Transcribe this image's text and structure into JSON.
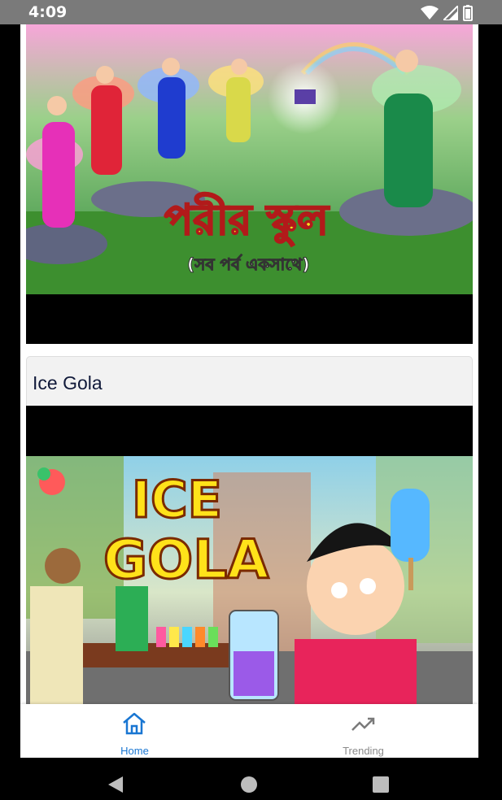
{
  "status_bar": {
    "time": "4:09",
    "icons": [
      "wifi-icon",
      "signal-icon",
      "battery-icon"
    ]
  },
  "videos": [
    {
      "title": "",
      "thumbnail_text": "পরীর স্কুল",
      "thumbnail_subtext": "(সব পর্ব একসাথে)"
    },
    {
      "title": "Ice Gola",
      "thumbnail_text_line1": "ICE",
      "thumbnail_text_line2": "GOLA"
    }
  ],
  "bottom_nav": {
    "items": [
      {
        "label": "Home",
        "icon": "home-icon",
        "active": true
      },
      {
        "label": "Trending",
        "icon": "trending-icon",
        "active": false
      }
    ],
    "active_color": "#1976d2",
    "inactive_color": "#8a8a8a"
  },
  "system_nav": {
    "icons": [
      "back-icon",
      "home-circle-icon",
      "recents-icon"
    ]
  }
}
